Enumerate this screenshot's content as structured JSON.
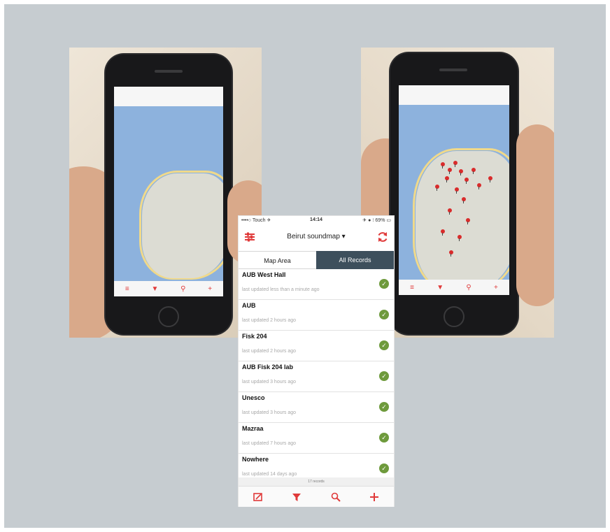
{
  "colors": {
    "accent": "#e03a3a",
    "segment_active": "#3d4f5c",
    "check": "#6e9a3c",
    "background": "#c6ccd0"
  },
  "status_bar": {
    "carrier": "••••○ Touch ✈",
    "time": "14:14",
    "battery": "✈ ● ⁝ 69% ▭"
  },
  "nav": {
    "title": "Beirut soundmap ▾",
    "left_icon": "settings-sliders-icon",
    "right_icon": "sync-icon"
  },
  "segments": {
    "map_area": "Map Area",
    "all_records": "All Records"
  },
  "records": [
    {
      "title": "AUB West Hall",
      "subtitle": "last updated less than a minute ago"
    },
    {
      "title": "AUB",
      "subtitle": "last updated 2 hours ago"
    },
    {
      "title": "Fisk 204",
      "subtitle": "last updated 2 hours ago"
    },
    {
      "title": "AUB Fisk 204 lab",
      "subtitle": "last updated 3 hours ago"
    },
    {
      "title": "Unesco",
      "subtitle": "last updated 3 hours ago"
    },
    {
      "title": "Mazraa",
      "subtitle": "last updated 7 hours ago"
    },
    {
      "title": "Nowhere",
      "subtitle": "last updated 14 days ago"
    }
  ],
  "records_count": "17 records",
  "check_glyph": "✓",
  "tabbar": [
    {
      "icon": "map-edit-icon",
      "glyph": "✎"
    },
    {
      "icon": "filter-icon",
      "glyph": "▼"
    },
    {
      "icon": "search-icon",
      "glyph": "⚲"
    },
    {
      "icon": "add-icon",
      "glyph": "+"
    }
  ]
}
